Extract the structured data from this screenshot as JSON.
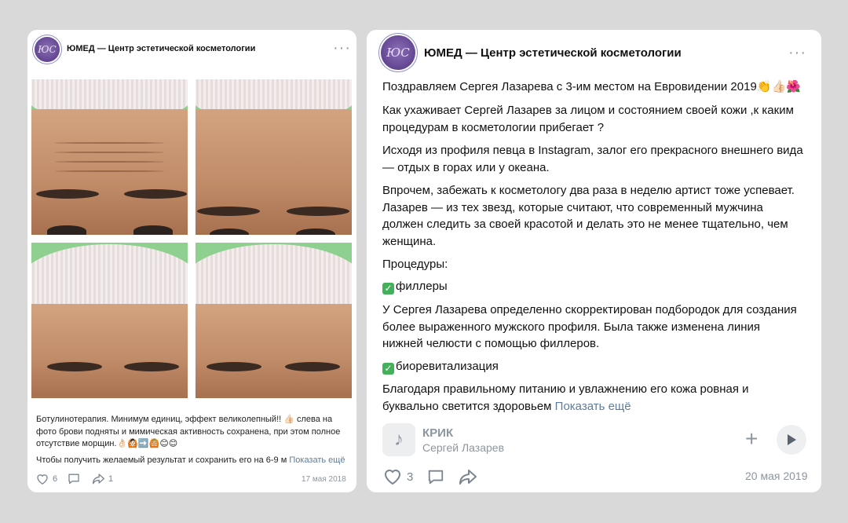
{
  "posts": [
    {
      "group_name": "ЮМЕД — Центр эстетической косметологии",
      "avatar_text": "ЮС",
      "text_line1": "Ботулинотерапия. Минимум единиц, эффект великолепный!! 👍🏻 слева на",
      "text_line2": "фото брови подняты и мимическая активность сохранена, при этом полное",
      "text_line3": "отсутствие морщин.👌🏻🙆🏻➡️🙆🏼😊😊",
      "text_line4": "Чтобы получить желаемый результат и сохранить его на 6-9 м",
      "show_more": "Показать ещё",
      "likes": "6",
      "reposts": "1",
      "date": "17 мая 2018"
    },
    {
      "group_name": "ЮМЕД — Центр эстетической косметологии",
      "avatar_text": "ЮС",
      "p1": "Поздравляем Сергея Лазарева с 3-им местом на Евровидении 2019👏👍🏻🌺",
      "p2a": "Как ухаживает Сергей Лазарев за лицом и состоянием своей кожи ,к каким",
      "p2b": "процедурам в косметологии прибегает ?",
      "p3a": "Исходя из профиля певца в Instagram, залог его прекрасного внешнего вида",
      "p3b": "— отдых в горах или у океана.",
      "p4a": "Впрочем, забежать к косметологу два раза в неделю артист тоже успевает.",
      "p4b": "Лазарев — из тех звезд, которые считают, что современный мужчина",
      "p4c": "должен следить за своей красотой и делать это не менее тщательно, чем",
      "p4d": "женщина.",
      "p5": "Процедуры:",
      "p6": "филлеры",
      "p7a": "У Сергея Лазарева определенно скорректирован подбородок для создания",
      "p7b": "более выраженного мужского профиля. Была также изменена линия",
      "p7c": "нижней челюсти с помощью филлеров.",
      "p8": "биоревитализация",
      "p9a": "Благодаря правильному питанию и увлажнению его кожа ровная и",
      "p9b": "буквально светится здоровьем",
      "show_more": "Показать ещё",
      "track_title": "КРИК",
      "track_artist": "Сергей Лазарев",
      "likes": "3",
      "date": "20 мая 2019"
    }
  ],
  "icons": {
    "more": "more-icon",
    "like": "heart-icon",
    "comment": "comment-icon",
    "share": "share-icon",
    "music": "music-note-icon",
    "add": "plus-icon",
    "play": "play-icon"
  },
  "colors": {
    "background": "#d9d9d9",
    "link": "#5f7c9c",
    "check": "#43b05c"
  }
}
